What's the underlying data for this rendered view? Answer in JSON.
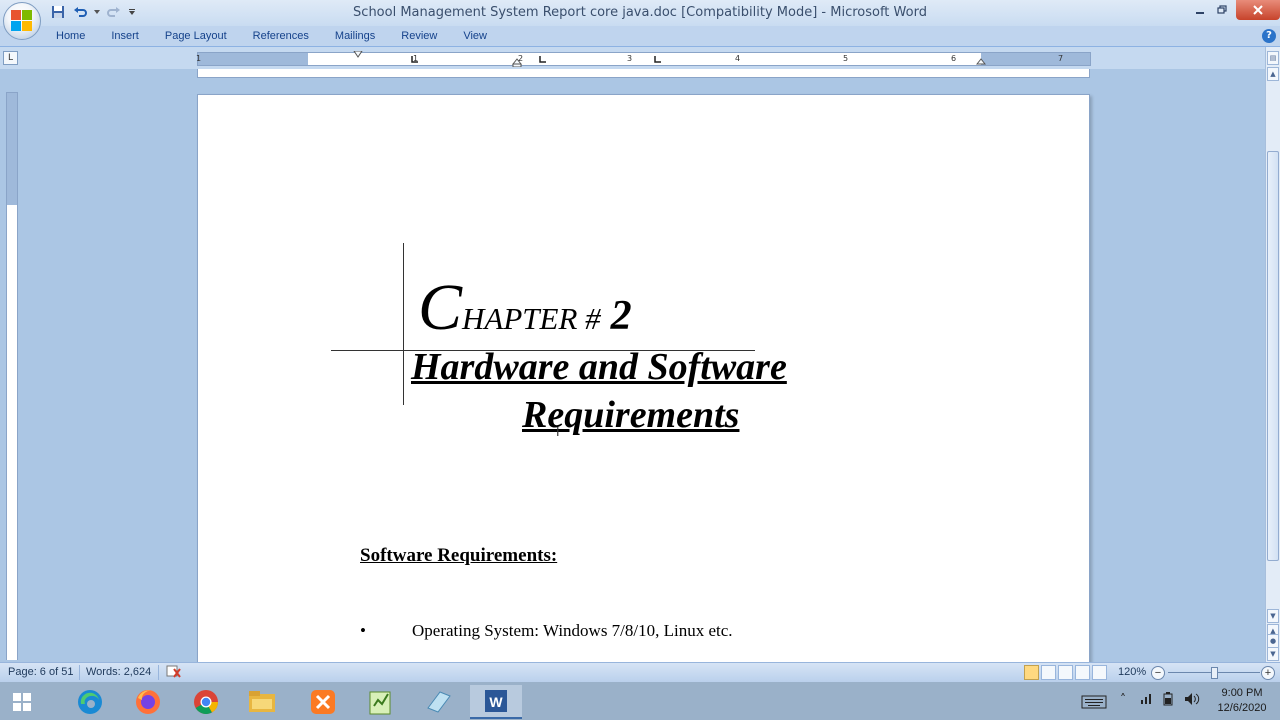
{
  "window": {
    "title": "School Management System Report core java.doc [Compatibility Mode] - Microsoft Word"
  },
  "ribbon": {
    "tabs": [
      "Home",
      "Insert",
      "Page Layout",
      "References",
      "Mailings",
      "Review",
      "View"
    ]
  },
  "ruler": {
    "numbers": [
      "1",
      "1",
      "2",
      "3",
      "4",
      "5",
      "6",
      "7"
    ]
  },
  "document": {
    "chapter_initial": "C",
    "chapter_rest": "HAPTER #",
    "chapter_number": "2",
    "heading_line1": "Hardware and Software",
    "heading_line2": "Requirements",
    "section_title": "Software Requirements:",
    "bullet_symbol": "•",
    "bullet_text": "Operating System: Windows 7/8/10, Linux etc."
  },
  "statusbar": {
    "page": "Page: 6 of 51",
    "words": "Words: 2,624",
    "zoom": "120%"
  },
  "taskbar": {
    "time": "9:00 PM",
    "date": "12/6/2020"
  },
  "colors": {
    "accent": "#15428b",
    "close_button": "#c7432b",
    "ribbon_bg": "#bfd4ee"
  }
}
